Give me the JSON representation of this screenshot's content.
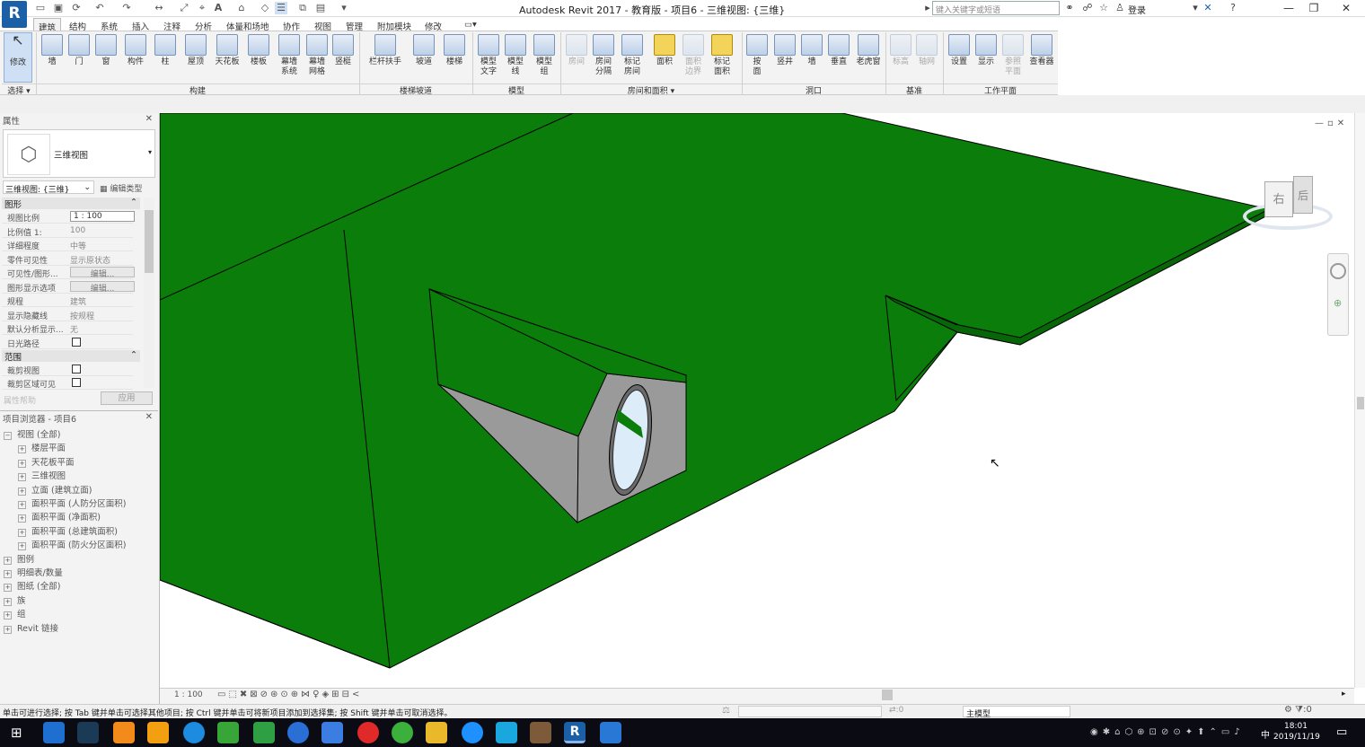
{
  "app": {
    "logo": "R",
    "title": "Autodesk Revit 2017 - 教育版 -    项目6 - 三维视图: {三维}",
    "search_placeholder": "键入关键字或短语",
    "login": "登录"
  },
  "tabs": [
    "建筑",
    "结构",
    "系统",
    "插入",
    "注释",
    "分析",
    "体量和场地",
    "协作",
    "视图",
    "管理",
    "附加模块",
    "修改"
  ],
  "ribbon": {
    "select": {
      "modify": "修改",
      "dropdown": "选择"
    },
    "build": {
      "panel": "构建",
      "items": [
        "墙",
        "门",
        "窗",
        "构件",
        "柱",
        "屋顶",
        "天花板",
        "楼板",
        "幕墙\n系统",
        "幕墙\n网格",
        "竖梃"
      ]
    },
    "stairs": {
      "panel": "楼梯坡道",
      "items": [
        "栏杆扶手",
        "坡道",
        "楼梯"
      ]
    },
    "model": {
      "panel": "模型",
      "items": [
        "模型\n文字",
        "模型\n线",
        "模型\n组"
      ]
    },
    "room": {
      "panel": "房间和面积",
      "items": [
        "房间",
        "房间\n分隔",
        "标记\n房间",
        "面积",
        "面积\n边界",
        "标记\n面积"
      ]
    },
    "opening": {
      "panel": "洞口",
      "items": [
        "按\n面",
        "竖井",
        "墙",
        "垂直",
        "老虎窗"
      ]
    },
    "datum": {
      "panel": "基准",
      "items": [
        "标高",
        "轴网"
      ]
    },
    "workplane": {
      "panel": "工作平面",
      "items": [
        "设置",
        "显示",
        "参照\n平面",
        "查看器"
      ]
    }
  },
  "properties": {
    "header": "属性",
    "type_name": "三维视图",
    "selector": "三维视图: {三维}",
    "edit_type": "编辑类型",
    "sections": {
      "graphics": "图形",
      "extents": "范围"
    },
    "rows": [
      {
        "k": "视图比例",
        "v": "1 : 100"
      },
      {
        "k": "比例值 1:",
        "v": "100"
      },
      {
        "k": "详细程度",
        "v": "中等"
      },
      {
        "k": "零件可见性",
        "v": "显示原状态"
      },
      {
        "k": "可见性/图形...",
        "v": "编辑..."
      },
      {
        "k": "图形显示选项",
        "v": "编辑..."
      },
      {
        "k": "规程",
        "v": "建筑"
      },
      {
        "k": "显示隐藏线",
        "v": "按规程"
      },
      {
        "k": "默认分析显示...",
        "v": "无"
      },
      {
        "k": "日光路径",
        "v": ""
      }
    ],
    "extent_rows": [
      {
        "k": "裁剪视图"
      },
      {
        "k": "裁剪区域可见"
      }
    ],
    "apply": "应用",
    "help": "属性帮助"
  },
  "browser": {
    "header": "项目浏览器 - 项目6",
    "items": [
      {
        "label": "视图 (全部)",
        "level": 0
      },
      {
        "label": "楼层平面",
        "level": 1
      },
      {
        "label": "天花板平面",
        "level": 1
      },
      {
        "label": "三维视图",
        "level": 1
      },
      {
        "label": "立面 (建筑立面)",
        "level": 1
      },
      {
        "label": "面积平面 (人防分区面积)",
        "level": 1
      },
      {
        "label": "面积平面 (净面积)",
        "level": 1
      },
      {
        "label": "面积平面 (总建筑面积)",
        "level": 1
      },
      {
        "label": "面积平面 (防火分区面积)",
        "level": 1
      },
      {
        "label": "图例",
        "level": 0
      },
      {
        "label": "明细表/数量",
        "level": 0
      },
      {
        "label": "图纸 (全部)",
        "level": 0
      },
      {
        "label": "族",
        "level": 0
      },
      {
        "label": "组",
        "level": 0
      },
      {
        "label": "Revit 链接",
        "level": 0
      }
    ]
  },
  "viewcube": {
    "face1": "右",
    "face2": "后"
  },
  "view_bar": {
    "scale": "1 : 100"
  },
  "status": {
    "text": "单击可进行选择; 按 Tab 键并单击可选择其他项目; 按 Ctrl 键并单击可将新项目添加到选择集; 按 Shift 键并单击可取消选择。",
    "count": ":0",
    "model": "主模型",
    "filter": ":0"
  },
  "clock": {
    "time": "18:01",
    "date": "2019/11/19"
  },
  "tray": {
    "ime": "中"
  },
  "colors": {
    "roof": "#0b7d0b",
    "wall": "#9a9a9a",
    "glass": "#dcecf8"
  }
}
